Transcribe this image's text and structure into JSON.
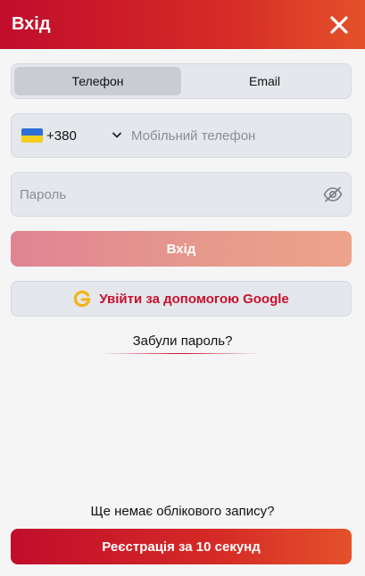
{
  "header": {
    "title": "Вхід",
    "close_icon": "close-icon",
    "gradient": [
      "#c10d2c",
      "#e4512a"
    ]
  },
  "tabs": [
    {
      "label": "Телефон",
      "active": true
    },
    {
      "label": "Email",
      "active": false
    }
  ],
  "phone": {
    "country_flag": "ukraine-flag-icon",
    "country_code": "+380",
    "placeholder": "Мобільний телефон"
  },
  "password": {
    "placeholder": "Пароль",
    "toggle_icon": "eye-off-icon"
  },
  "login_button": {
    "label": "Вхід"
  },
  "google_button": {
    "label": "Увійти за допомогою Google",
    "icon": "google-icon",
    "color": "#c8102e"
  },
  "forgot": {
    "label": "Забули пароль?"
  },
  "footer": {
    "no_account": "Ще немає облікового запису?",
    "register_label": "Реєстрація за 10 секунд"
  }
}
